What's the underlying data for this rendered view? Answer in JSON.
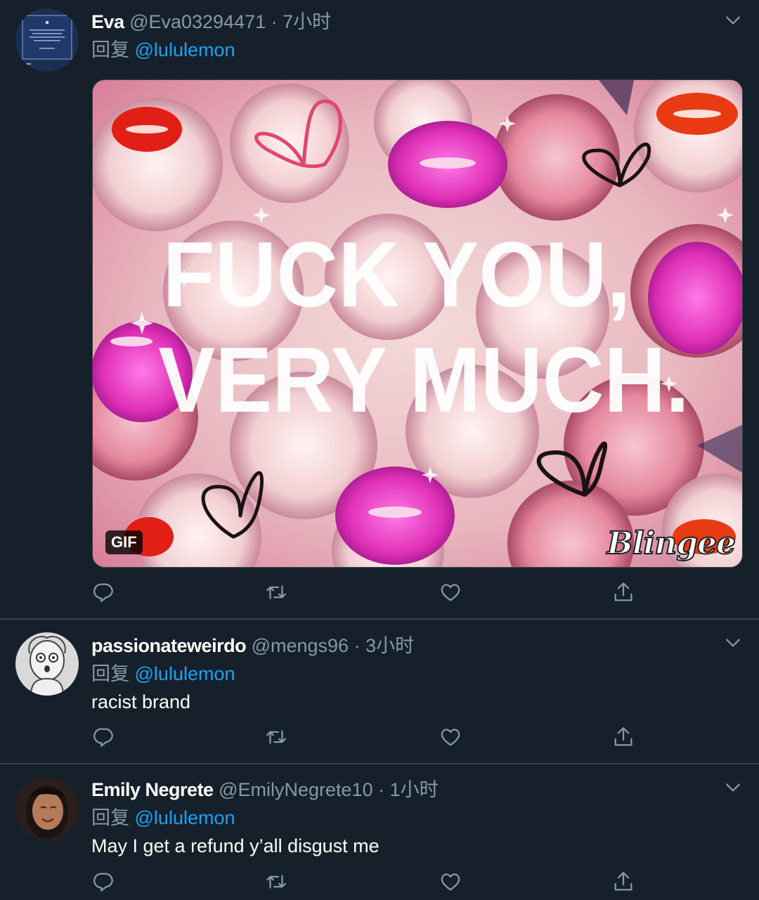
{
  "tweets": [
    {
      "name": "Eva",
      "handle": "@Eva03294471",
      "separator": "·",
      "time": "7小时",
      "reply_prefix": "回复",
      "reply_to": "@lululemon",
      "text": "",
      "media": {
        "badge": "GIF",
        "overlay_line1": "FUCK YOU,",
        "overlay_line2": "VERY MUCH.",
        "watermark": "Blingee"
      }
    },
    {
      "name": "passionateweirdo",
      "handle": "@mengs96",
      "separator": "·",
      "time": "3小时",
      "reply_prefix": "回复",
      "reply_to": "@lululemon",
      "text": "racist brand"
    },
    {
      "name": "Emily Negrete",
      "handle": "@EmilyNegrete10",
      "separator": "·",
      "time": "1小时",
      "reply_prefix": "回复",
      "reply_to": "@lululemon",
      "text": "May I get a refund y’all disgust me"
    }
  ],
  "icons": {
    "reply": "reply-icon",
    "retweet": "retweet-icon",
    "like": "heart-icon",
    "share": "share-icon",
    "more": "chevron-down-icon"
  },
  "colors": {
    "background": "#15202b",
    "secondary_text": "#8899a6",
    "mention": "#1da1f2",
    "divider": "#38444d"
  }
}
